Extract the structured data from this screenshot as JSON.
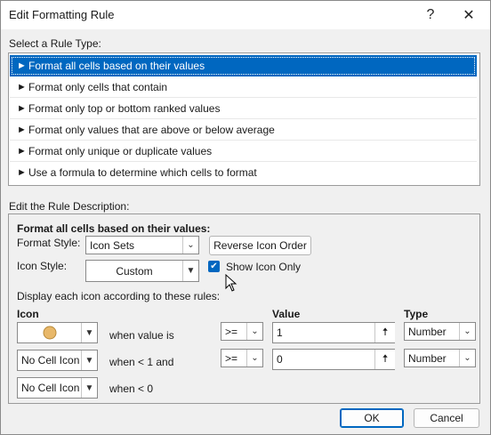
{
  "window": {
    "title": "Edit Formatting Rule",
    "help_glyph": "?",
    "close_glyph": "✕"
  },
  "rule_type": {
    "label": "Select a Rule Type:",
    "items": [
      {
        "label": "Format all cells based on their values",
        "selected": true
      },
      {
        "label": "Format only cells that contain",
        "selected": false
      },
      {
        "label": "Format only top or bottom ranked values",
        "selected": false
      },
      {
        "label": "Format only values that are above or below average",
        "selected": false
      },
      {
        "label": "Format only unique or duplicate values",
        "selected": false
      },
      {
        "label": "Use a formula to determine which cells to format",
        "selected": false
      }
    ]
  },
  "description": {
    "label": "Edit the Rule Description:",
    "heading": "Format all cells based on their values:",
    "format_style_label": "Format Style:",
    "format_style_value": "Icon Sets",
    "reverse_button": "Reverse Icon Order",
    "icon_style_label": "Icon Style:",
    "icon_style_value": "Custom",
    "show_icon_only_label": "Show Icon Only",
    "show_icon_only_checked": true,
    "display_rules_label": "Display each icon according to these rules:",
    "col_icon": "Icon",
    "col_value": "Value",
    "col_type": "Type",
    "rows": [
      {
        "icon": "yellow-circle",
        "icon_label": "",
        "condition": "when value is",
        "operator": ">=",
        "value": "1",
        "type": "Number"
      },
      {
        "icon": "none",
        "icon_label": "No Cell Icon",
        "condition": "when < 1 and",
        "operator": ">=",
        "value": "0",
        "type": "Number"
      },
      {
        "icon": "none",
        "icon_label": "No Cell Icon",
        "condition": "when < 0"
      }
    ],
    "circle_color": "#e8b86a"
  },
  "buttons": {
    "ok": "OK",
    "cancel": "Cancel"
  },
  "colors": {
    "accent": "#0067c0"
  }
}
